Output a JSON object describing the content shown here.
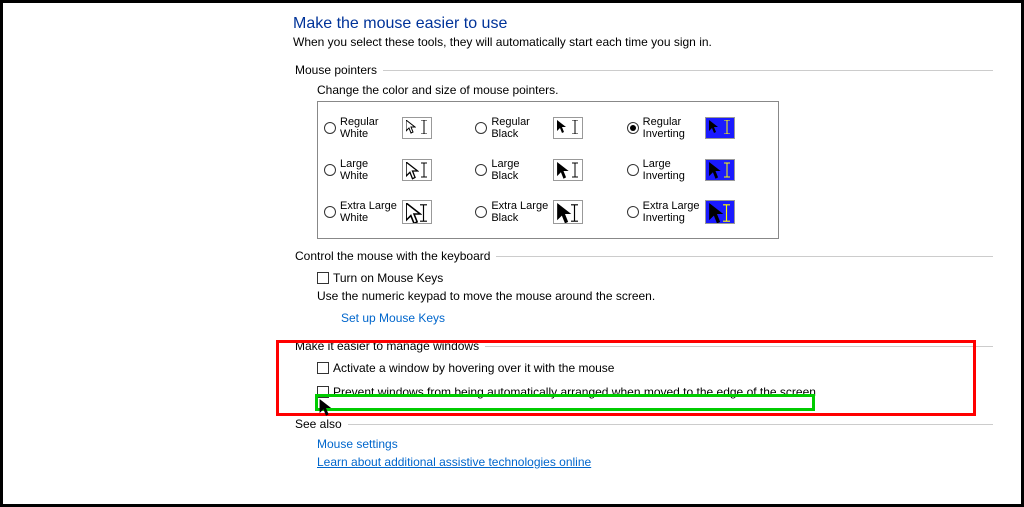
{
  "header": {
    "title": "Make the mouse easier to use",
    "subtitle": "When you select these tools, they will automatically start each time you sign in."
  },
  "mouse_pointers": {
    "legend": "Mouse pointers",
    "desc": "Change the color and size of mouse pointers.",
    "options": {
      "reg_white": "Regular White",
      "reg_black": "Regular Black",
      "reg_inv": "Regular Inverting",
      "lg_white": "Large White",
      "lg_black": "Large Black",
      "lg_inv": "Large Inverting",
      "xl_white": "Extra Large White",
      "xl_black": "Extra Large Black",
      "xl_inv": "Extra Large Inverting"
    },
    "selected": "reg_inv"
  },
  "keyboard": {
    "legend": "Control the mouse with the keyboard",
    "mousekeys_label": "Turn on Mouse Keys",
    "mousekeys_desc": "Use the numeric keypad to move the mouse around the screen.",
    "setup_link": "Set up Mouse Keys"
  },
  "windows": {
    "legend": "Make it easier to manage windows",
    "activate_hover": "Activate a window by hovering over it with the mouse",
    "prevent_arrange": "Prevent windows from being automatically arranged when moved to the edge of the screen"
  },
  "see_also": {
    "legend": "See also",
    "mouse_settings": "Mouse settings",
    "learn": "Learn about additional assistive technologies online"
  }
}
